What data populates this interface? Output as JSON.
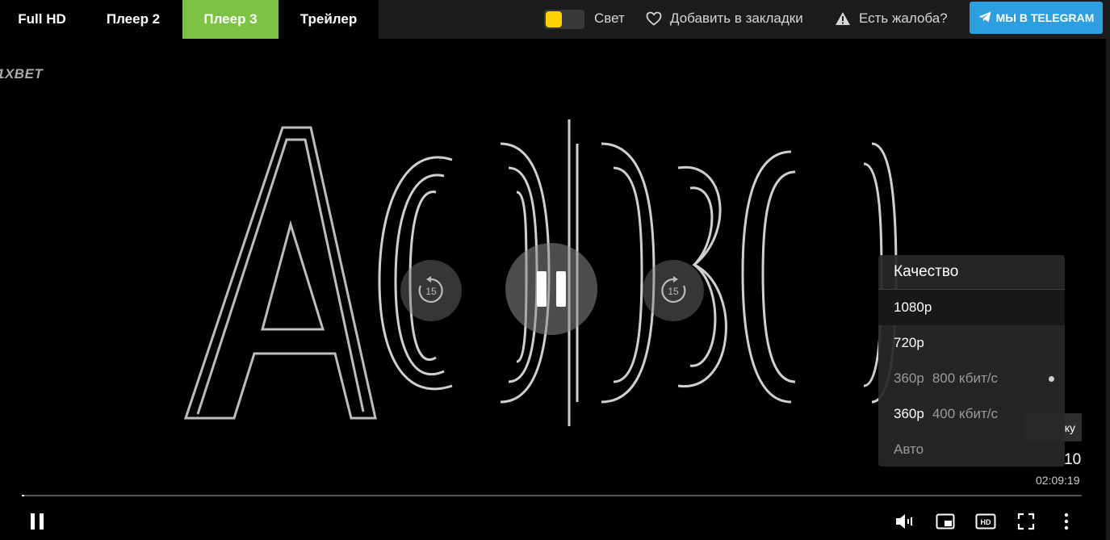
{
  "tabs": [
    {
      "label": "Full HD"
    },
    {
      "label": "Плеер 2"
    },
    {
      "label": "Плеер 3"
    },
    {
      "label": "Трейлер"
    }
  ],
  "topbar": {
    "light_label": "Свет",
    "bookmark_label": "Добавить в закладки",
    "complaint_label": "Есть жалоба?",
    "telegram_label": "МЫ В TELEGRAM"
  },
  "player": {
    "watermark": "1XBET",
    "rewind_seconds": "15",
    "forward_seconds": "15",
    "current_time_partial": "10",
    "total_time": "02:09:19",
    "tooltip_partial": "ку",
    "progress_fraction": 0.002
  },
  "quality_menu": {
    "title": "Качество",
    "items": [
      {
        "label": "1080p",
        "sub": ""
      },
      {
        "label": "720p",
        "sub": ""
      },
      {
        "label": "360p",
        "sub": "800 кбит/с"
      },
      {
        "label": "360p",
        "sub": "400 кбит/с"
      },
      {
        "label": "Авто",
        "sub": ""
      }
    ]
  },
  "colors": {
    "accent_green": "#7cc244",
    "telegram_blue": "#2b9fe0",
    "toggle_yellow": "#ffd300"
  }
}
